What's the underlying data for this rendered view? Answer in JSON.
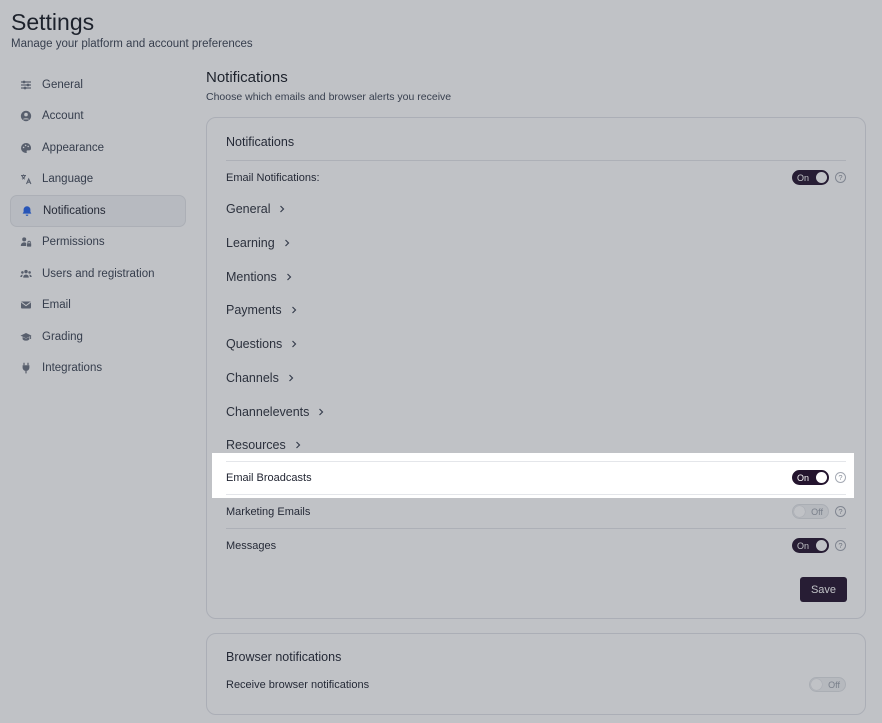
{
  "page": {
    "title": "Settings",
    "subtitle": "Manage your platform and account preferences"
  },
  "sidebar": {
    "items": [
      {
        "label": "General",
        "icon": "sliders-icon"
      },
      {
        "label": "Account",
        "icon": "user-circle-icon"
      },
      {
        "label": "Appearance",
        "icon": "palette-icon"
      },
      {
        "label": "Language",
        "icon": "translate-icon"
      },
      {
        "label": "Notifications",
        "icon": "bell-icon",
        "active": true
      },
      {
        "label": "Permissions",
        "icon": "user-lock-icon"
      },
      {
        "label": "Users and registration",
        "icon": "users-icon"
      },
      {
        "label": "Email",
        "icon": "envelope-icon"
      },
      {
        "label": "Grading",
        "icon": "graduation-cap-icon"
      },
      {
        "label": "Integrations",
        "icon": "plug-icon"
      }
    ]
  },
  "section": {
    "title": "Notifications",
    "subtitle": "Choose which emails and browser alerts you receive"
  },
  "email_card": {
    "title": "Notifications",
    "email_notifications": {
      "label": "Email Notifications:",
      "state": "On"
    },
    "categories": [
      "General",
      "Learning",
      "Mentions",
      "Payments",
      "Questions",
      "Channels",
      "Channelevents",
      "Resources"
    ],
    "email_broadcasts": {
      "label": "Email Broadcasts",
      "state": "On"
    },
    "marketing_emails": {
      "label": "Marketing Emails",
      "state": "Off"
    },
    "messages": {
      "label": "Messages",
      "state": "On"
    },
    "save_label": "Save"
  },
  "browser_card": {
    "title": "Browser notifications",
    "receive": {
      "label": "Receive browser notifications",
      "state": "Off"
    }
  },
  "help_glyph": "?",
  "colors": {
    "accent": "#24142e",
    "active_bg": "#f3f4f6",
    "bell_blue": "#2563eb"
  }
}
